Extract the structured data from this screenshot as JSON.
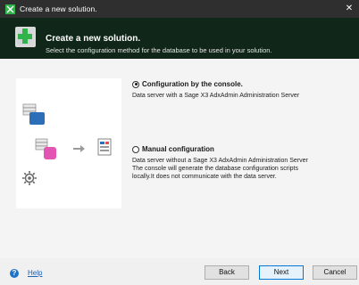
{
  "window": {
    "title": "Create a new solution."
  },
  "header": {
    "title": "Create a new solution.",
    "subtitle": "Select the configuration method for the database to be used in your solution."
  },
  "options": [
    {
      "label": "Configuration by the console.",
      "selected": true,
      "description_lines": [
        "Data server with a Sage X3 AdxAdmin Administration Server"
      ]
    },
    {
      "label": "Manual configuration",
      "selected": false,
      "description_lines": [
        "Data server without a Sage X3 AdxAdmin Administration Server",
        "The console will generate the database configuration scripts",
        "locally.It does not communicate with the data server."
      ]
    }
  ],
  "footer": {
    "help_label": "Help",
    "back_label": "Back",
    "next_label": "Next",
    "cancel_label": "Cancel"
  },
  "colors": {
    "header_bg": "#0f2618",
    "titlebar_bg": "#2f2f2f",
    "accent": "#0078d7"
  }
}
